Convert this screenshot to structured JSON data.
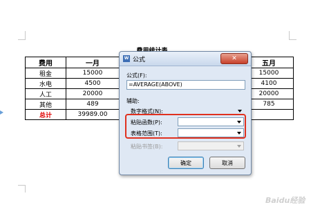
{
  "doc": {
    "title": "费用统计表",
    "table": {
      "headers": [
        "费用",
        "一月",
        "",
        "五月"
      ],
      "rows": [
        [
          "租金",
          "15000",
          "",
          "15000"
        ],
        [
          "水电",
          "4500",
          "",
          "4100"
        ],
        [
          "人工",
          "20000",
          "",
          "20000"
        ],
        [
          "其他",
          "489",
          "",
          "785"
        ]
      ],
      "total_label": "总计",
      "total_value": "39989.00"
    }
  },
  "dialog": {
    "title": "公式",
    "close_glyph": "✕",
    "formula_label": "公式(F):",
    "formula_value": "=AVERAGE(ABOVE)",
    "aux_label": "辅助:",
    "number_format_label": "数字格式(N):",
    "paste_function_label": "粘贴函数(P):",
    "table_range_label": "表格范围(T):",
    "paste_bookmark_label": "粘贴书签(B):",
    "ok_label": "确定",
    "cancel_label": "取消"
  },
  "colors": {
    "highlight": "#e0301e",
    "total_text": "#e00000"
  },
  "watermark": "Baidu经验"
}
